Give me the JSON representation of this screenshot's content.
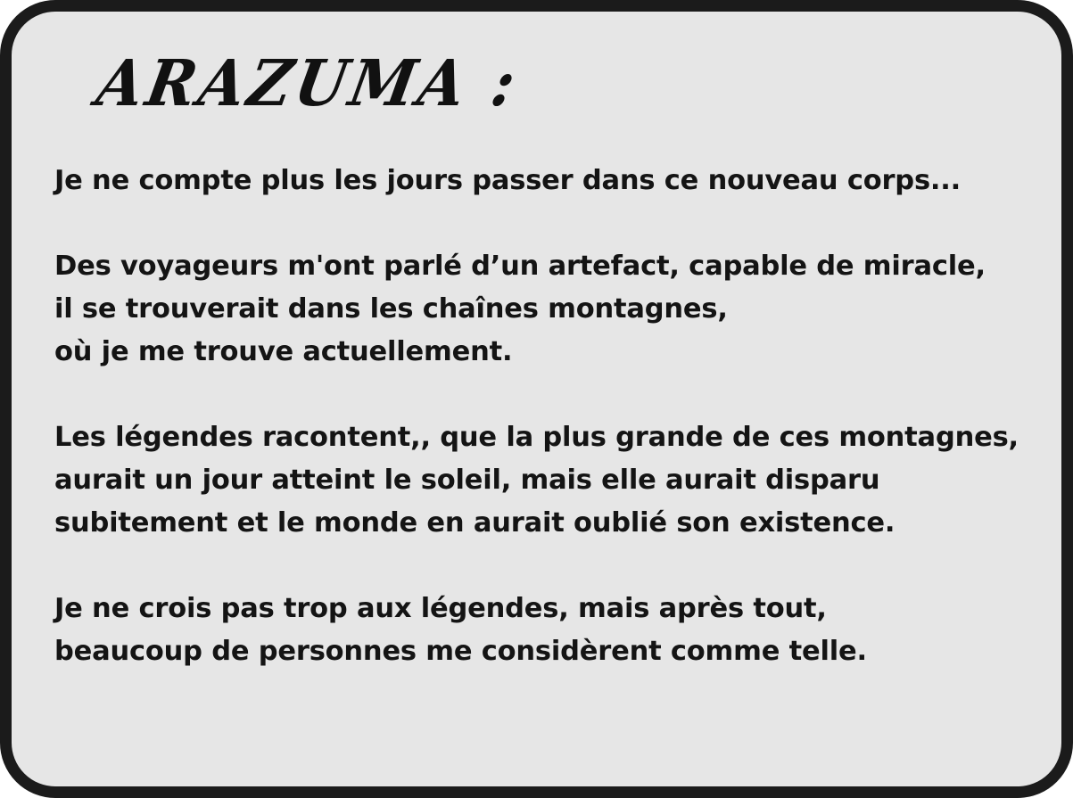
{
  "speaker": {
    "name": "ARAZUMA :"
  },
  "dialog": {
    "paragraphs": [
      {
        "lines": [
          "Je ne compte plus les jours passer dans ce nouveau corps..."
        ]
      },
      {
        "lines": [
          "Des voyageurs m'ont parlé d’un artefact, capable de miracle,",
          "il se trouverait dans les chaînes montagnes,",
          "où je me trouve actuellement."
        ]
      },
      {
        "lines": [
          "Les légendes racontent,, que la plus grande de ces montagnes,",
          "aurait un jour atteint le soleil, mais elle aurait disparu",
          "subitement et le monde en aurait oublié son existence."
        ]
      },
      {
        "lines": [
          "Je ne crois pas trop aux légendes, mais après tout,",
          "beaucoup de personnes me considèrent comme telle."
        ]
      }
    ]
  },
  "colors": {
    "background": "#e6e6e6",
    "border": "#1b1b1b",
    "text": "#141414"
  }
}
